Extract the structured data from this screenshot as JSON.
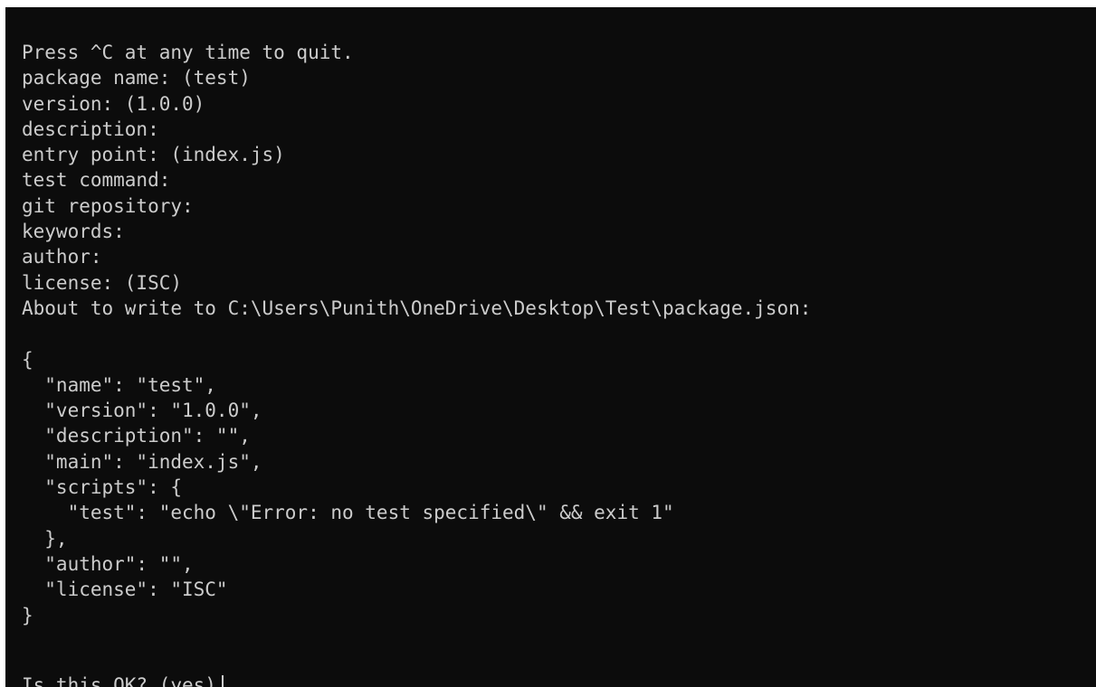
{
  "terminal": {
    "lines": [
      "Press ^C at any time to quit.",
      "package name: (test)",
      "version: (1.0.0)",
      "description:",
      "entry point: (index.js)",
      "test command:",
      "git repository:",
      "keywords:",
      "author:",
      "license: (ISC)",
      "About to write to C:\\Users\\Punith\\OneDrive\\Desktop\\Test\\package.json:",
      "",
      "{",
      "  \"name\": \"test\",",
      "  \"version\": \"1.0.0\",",
      "  \"description\": \"\",",
      "  \"main\": \"index.js\",",
      "  \"scripts\": {",
      "    \"test\": \"echo \\\"Error: no test specified\\\" && exit 1\"",
      "  },",
      "  \"author\": \"\",",
      "  \"license\": \"ISC\"",
      "}"
    ],
    "prompt": "Is this OK? (yes)",
    "input_value": ""
  },
  "colors": {
    "background": "#0c0c0c",
    "foreground": "#cccccc"
  }
}
